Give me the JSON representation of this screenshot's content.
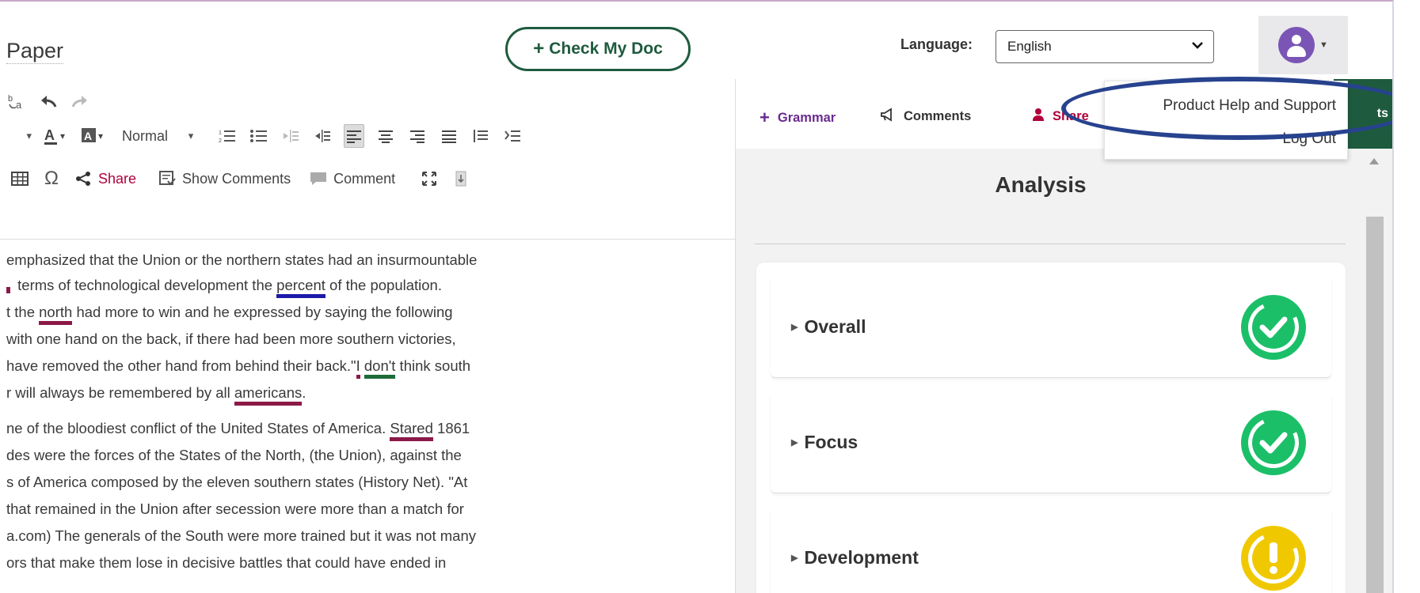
{
  "header": {
    "doc_title": "Paper",
    "check_button": "Check My Doc",
    "language_label": "Language:",
    "language_value": "English"
  },
  "toolbar": {
    "style_value": "Normal",
    "share_label": "Share",
    "show_comments_label": "Show Comments",
    "comment_label": "Comment"
  },
  "document": {
    "lines": [
      {
        "parts": [
          {
            "t": "emphasized that the Union or the northern states had an insurmountable"
          }
        ]
      },
      {
        "parts": [
          {
            "t": "",
            "mark": "mini-red"
          },
          {
            "t": " terms of technological development the "
          },
          {
            "t": "percent",
            "u": "blue"
          },
          {
            "t": " of the population."
          }
        ]
      },
      {
        "parts": [
          {
            "t": "t the "
          },
          {
            "t": "north",
            "u": "red"
          },
          {
            "t": " had more to win and he expressed by saying the following"
          }
        ]
      },
      {
        "parts": [
          {
            "t": " with one hand on the back, if there had been more southern victories,"
          }
        ]
      },
      {
        "parts": [
          {
            "t": "have removed the other hand from behind their back.\""
          },
          {
            "t": "I",
            "u": "red"
          },
          {
            "t": " "
          },
          {
            "t": "don't",
            "u": "green"
          },
          {
            "t": " think south"
          }
        ]
      },
      {
        "parts": [
          {
            "t": "r will always be remembered by all "
          },
          {
            "t": "americans",
            "u": "red"
          },
          {
            "t": "."
          }
        ]
      },
      {
        "parts": [
          {
            "t": "ne of the bloodiest conflict of the United States of America. "
          },
          {
            "t": "Stared",
            "u": "red"
          },
          {
            "t": " 1861"
          }
        ]
      },
      {
        "parts": [
          {
            "t": "des were the forces of the States of the North, (the Union), against the"
          }
        ]
      },
      {
        "parts": [
          {
            "t": "s of America composed by the eleven southern states (History Net). \"At"
          }
        ]
      },
      {
        "parts": [
          {
            "t": " that remained in the Union after secession were more than a match for"
          }
        ]
      },
      {
        "parts": [
          {
            "t": "a.com)  The generals of the South were more trained but it was not many"
          }
        ]
      },
      {
        "parts": [
          {
            "t": "ors that make them lose in decisive battles that could have ended in"
          }
        ]
      }
    ]
  },
  "panel": {
    "tabs": {
      "grammar": "Grammar",
      "comments": "Comments",
      "share": "Share",
      "right_strip": "ts"
    },
    "title": "Analysis",
    "items": [
      {
        "label": "Overall",
        "status": "ok"
      },
      {
        "label": "Focus",
        "status": "ok"
      },
      {
        "label": "Development",
        "status": "warn"
      }
    ]
  },
  "user_menu": {
    "help": "Product Help and Support",
    "logout": "Log Out"
  },
  "colors": {
    "brand_green": "#1e5b3e",
    "grammar_purple": "#6a2b8f",
    "share_red": "#b0003a",
    "ok_green": "#1bbf68",
    "warn_yellow": "#f0c800",
    "highlight_blue": "#27428e"
  }
}
